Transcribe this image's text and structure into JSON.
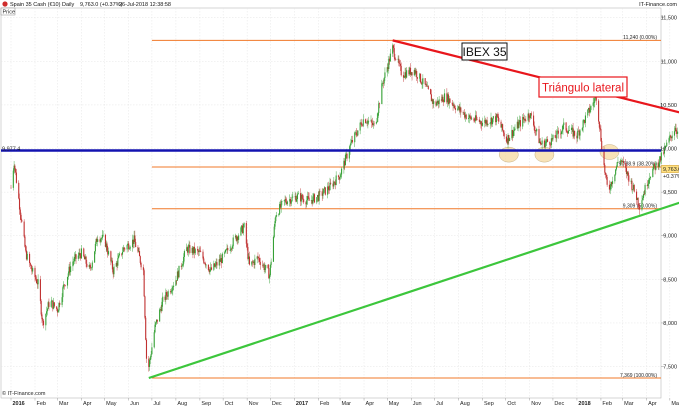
{
  "header": {
    "instrument": "Spain 35 Cash (€10)",
    "timeframe": "Daily",
    "quote": "9,763.0 (+0.37%)",
    "timestamp": "26-Jul-2018 12:38:58",
    "price_label": "Price",
    "brand": "IT-Finance.com"
  },
  "footer": {
    "copyright": "© IT-Finance.com"
  },
  "annotations": {
    "ibex_label": "IBEX 35",
    "triangle_label": "Triángulo lateral",
    "support_value": "9,977.4"
  },
  "colors": {
    "resistance_line": "#e8161c",
    "support_line": "#3cc63c",
    "horizontal_level": "#1212b0",
    "fib_line": "#f07828",
    "candle_up": "#35a035",
    "candle_down": "#c03030",
    "price_tag": "#ffe080",
    "ellipse_orange": "#f5d79a",
    "ellipse_blue": "#9aaee0"
  },
  "chart_data": {
    "type": "line",
    "title": "Spain 35 Cash (€10)",
    "xlabel": "",
    "ylabel": "Price",
    "ylim": [
      7250,
      11600
    ],
    "grid": true,
    "last_price": "9,763.0",
    "last_change": "+0.37%",
    "y_ticks": [
      7500,
      8000,
      8500,
      9000,
      9500,
      10000,
      10500,
      11000,
      11500
    ],
    "y_tick_labels": [
      "7,500",
      "8,000",
      "8,500",
      "9,000",
      "9,500",
      "10,000",
      "10,500",
      "11,000",
      "11,500"
    ],
    "x_ticks": [
      {
        "date": "2016-01-01",
        "label": "2016",
        "bold": true
      },
      {
        "date": "2016-02-01",
        "label": "Feb"
      },
      {
        "date": "2016-03-01",
        "label": "Mar"
      },
      {
        "date": "2016-04-01",
        "label": "Apr"
      },
      {
        "date": "2016-05-01",
        "label": "May"
      },
      {
        "date": "2016-06-01",
        "label": "Jun"
      },
      {
        "date": "2016-07-01",
        "label": "Jul"
      },
      {
        "date": "2016-08-01",
        "label": "Aug"
      },
      {
        "date": "2016-09-01",
        "label": "Sep"
      },
      {
        "date": "2016-10-01",
        "label": "Oct"
      },
      {
        "date": "2016-11-01",
        "label": "Nov"
      },
      {
        "date": "2016-12-01",
        "label": "Dec"
      },
      {
        "date": "2017-01-01",
        "label": "2017",
        "bold": true
      },
      {
        "date": "2017-02-01",
        "label": "Feb"
      },
      {
        "date": "2017-03-01",
        "label": "Mar"
      },
      {
        "date": "2017-04-01",
        "label": "Apr"
      },
      {
        "date": "2017-05-01",
        "label": "May"
      },
      {
        "date": "2017-06-01",
        "label": "Jun"
      },
      {
        "date": "2017-07-01",
        "label": "Jul"
      },
      {
        "date": "2017-08-01",
        "label": "Aug"
      },
      {
        "date": "2017-09-01",
        "label": "Sep"
      },
      {
        "date": "2017-10-01",
        "label": "Oct"
      },
      {
        "date": "2017-11-01",
        "label": "Nov"
      },
      {
        "date": "2017-12-01",
        "label": "Dec"
      },
      {
        "date": "2018-01-01",
        "label": "2018",
        "bold": true
      },
      {
        "date": "2018-02-01",
        "label": "Feb"
      },
      {
        "date": "2018-03-01",
        "label": "Mar"
      },
      {
        "date": "2018-04-01",
        "label": "Apr"
      },
      {
        "date": "2018-05-01",
        "label": "May"
      },
      {
        "date": "2018-06-01",
        "label": "Jun"
      },
      {
        "date": "2018-07-01",
        "label": "Jul"
      },
      {
        "date": "2018-08-01",
        "label": "Aug"
      }
    ],
    "fib_levels": [
      {
        "value": 11240,
        "label": "11,240 (0.00%)",
        "start": "2016-07-01"
      },
      {
        "value": 9788.9,
        "label": "9,788.9 (38.20%)",
        "start": "2016-07-01"
      },
      {
        "value": 9309,
        "label": "9,309 (50.00%)",
        "start": "2016-07-01"
      },
      {
        "value": 7369,
        "label": "7,369 (100.00%)",
        "start": "2016-07-01"
      }
    ],
    "horizontal_support": {
      "value": 9977.4,
      "label": "9,977.4"
    },
    "trendlines": [
      {
        "name": "resistance",
        "points": [
          {
            "x": "2017-05-08",
            "y": 11240
          },
          {
            "x": "2018-08-31",
            "y": 10170
          }
        ]
      },
      {
        "name": "support",
        "points": [
          {
            "x": "2016-06-27",
            "y": 7369
          },
          {
            "x": "2018-08-31",
            "y": 9700
          }
        ]
      }
    ],
    "series": [
      {
        "values": [
          {
            "x": "2016-01-01",
            "y": 9550
          },
          {
            "x": "2016-01-05",
            "y": 9850
          },
          {
            "x": "2016-01-12",
            "y": 9350
          },
          {
            "x": "2016-01-20",
            "y": 8800
          },
          {
            "x": "2016-01-28",
            "y": 8600
          },
          {
            "x": "2016-02-05",
            "y": 8450
          },
          {
            "x": "2016-02-11",
            "y": 8000
          },
          {
            "x": "2016-02-20",
            "y": 8250
          },
          {
            "x": "2016-03-01",
            "y": 8150
          },
          {
            "x": "2016-03-10",
            "y": 8450
          },
          {
            "x": "2016-03-20",
            "y": 8700
          },
          {
            "x": "2016-04-01",
            "y": 8800
          },
          {
            "x": "2016-04-12",
            "y": 8600
          },
          {
            "x": "2016-04-22",
            "y": 9000
          },
          {
            "x": "2016-05-01",
            "y": 8950
          },
          {
            "x": "2016-05-12",
            "y": 8600
          },
          {
            "x": "2016-05-25",
            "y": 8850
          },
          {
            "x": "2016-06-08",
            "y": 8950
          },
          {
            "x": "2016-06-20",
            "y": 8600
          },
          {
            "x": "2016-06-24",
            "y": 7600
          },
          {
            "x": "2016-06-27",
            "y": 7500
          },
          {
            "x": "2016-07-05",
            "y": 7950
          },
          {
            "x": "2016-07-15",
            "y": 8250
          },
          {
            "x": "2016-08-01",
            "y": 8500
          },
          {
            "x": "2016-08-15",
            "y": 8850
          },
          {
            "x": "2016-09-01",
            "y": 8800
          },
          {
            "x": "2016-09-15",
            "y": 8600
          },
          {
            "x": "2016-10-01",
            "y": 8750
          },
          {
            "x": "2016-10-15",
            "y": 8950
          },
          {
            "x": "2016-10-28",
            "y": 9100
          },
          {
            "x": "2016-11-04",
            "y": 8650
          },
          {
            "x": "2016-11-15",
            "y": 8750
          },
          {
            "x": "2016-11-30",
            "y": 8550
          },
          {
            "x": "2016-12-08",
            "y": 9250
          },
          {
            "x": "2016-12-20",
            "y": 9400
          },
          {
            "x": "2017-01-05",
            "y": 9450
          },
          {
            "x": "2017-01-20",
            "y": 9400
          },
          {
            "x": "2017-02-01",
            "y": 9450
          },
          {
            "x": "2017-02-15",
            "y": 9550
          },
          {
            "x": "2017-03-01",
            "y": 9700
          },
          {
            "x": "2017-03-15",
            "y": 10050
          },
          {
            "x": "2017-04-01",
            "y": 10350
          },
          {
            "x": "2017-04-15",
            "y": 10250
          },
          {
            "x": "2017-04-25",
            "y": 10750
          },
          {
            "x": "2017-05-08",
            "y": 11150
          },
          {
            "x": "2017-05-20",
            "y": 10850
          },
          {
            "x": "2017-06-05",
            "y": 10900
          },
          {
            "x": "2017-06-20",
            "y": 10700
          },
          {
            "x": "2017-07-01",
            "y": 10500
          },
          {
            "x": "2017-07-15",
            "y": 10600
          },
          {
            "x": "2017-08-01",
            "y": 10450
          },
          {
            "x": "2017-08-15",
            "y": 10350
          },
          {
            "x": "2017-09-01",
            "y": 10300
          },
          {
            "x": "2017-09-20",
            "y": 10350
          },
          {
            "x": "2017-10-02",
            "y": 10100
          },
          {
            "x": "2017-10-15",
            "y": 10250
          },
          {
            "x": "2017-11-01",
            "y": 10400
          },
          {
            "x": "2017-11-15",
            "y": 10050
          },
          {
            "x": "2017-12-01",
            "y": 10100
          },
          {
            "x": "2017-12-15",
            "y": 10250
          },
          {
            "x": "2018-01-01",
            "y": 10150
          },
          {
            "x": "2018-01-15",
            "y": 10400
          },
          {
            "x": "2018-01-26",
            "y": 10600
          },
          {
            "x": "2018-02-05",
            "y": 9800
          },
          {
            "x": "2018-02-10",
            "y": 9500
          },
          {
            "x": "2018-02-25",
            "y": 9900
          },
          {
            "x": "2018-03-10",
            "y": 9650
          },
          {
            "x": "2018-03-23",
            "y": 9350
          },
          {
            "x": "2018-04-05",
            "y": 9700
          },
          {
            "x": "2018-04-20",
            "y": 9900
          },
          {
            "x": "2018-05-08",
            "y": 10250
          },
          {
            "x": "2018-05-20",
            "y": 10000
          },
          {
            "x": "2018-05-29",
            "y": 9450
          },
          {
            "x": "2018-06-08",
            "y": 9850
          },
          {
            "x": "2018-06-20",
            "y": 9750
          },
          {
            "x": "2018-06-28",
            "y": 9550
          },
          {
            "x": "2018-07-10",
            "y": 9800
          },
          {
            "x": "2018-07-20",
            "y": 9650
          },
          {
            "x": "2018-07-26",
            "y": 9763
          }
        ]
      }
    ]
  }
}
